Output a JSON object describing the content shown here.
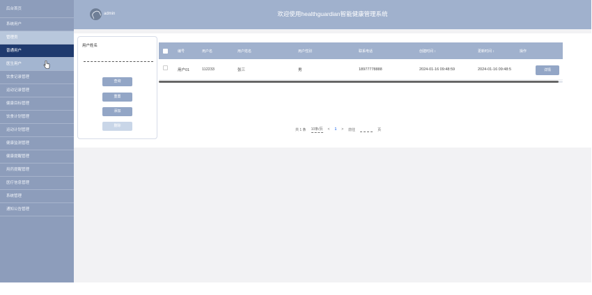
{
  "sidebar": {
    "items": [
      {
        "label": "后台首页",
        "state": "normal"
      },
      {
        "label": "系统用户",
        "state": "normal"
      },
      {
        "label": "管理员",
        "state": "light"
      },
      {
        "label": "普通用户",
        "state": "active"
      },
      {
        "label": "医生用户",
        "state": "mid"
      },
      {
        "label": "饮食记录管理",
        "state": "normal"
      },
      {
        "label": "运动记录管理",
        "state": "normal"
      },
      {
        "label": "健康目标管理",
        "state": "normal"
      },
      {
        "label": "饮食计划管理",
        "state": "normal"
      },
      {
        "label": "运动计划管理",
        "state": "normal"
      },
      {
        "label": "健康监测管理",
        "state": "normal"
      },
      {
        "label": "健康提醒管理",
        "state": "normal"
      },
      {
        "label": "用药提醒管理",
        "state": "normal"
      },
      {
        "label": "医疗信息管理",
        "state": "normal"
      },
      {
        "label": "系统管理",
        "state": "normal"
      },
      {
        "label": "通知公告管理",
        "state": "normal"
      }
    ]
  },
  "header": {
    "admin_name": "admin",
    "title": "欢迎使用healthguardian智能健康管理系统"
  },
  "search": {
    "label": "用户姓名",
    "input_value": "",
    "query_label": "查询",
    "reset_label": "重置",
    "add_label": "添加",
    "delete_label": "删除"
  },
  "table": {
    "columns": [
      "编号",
      "用户名",
      "用户姓名",
      "用户性别",
      "联系电话",
      "创建时间 ↕",
      "更新时间 ↕",
      "操作"
    ],
    "rows": [
      {
        "id": "用户01",
        "username": "112233",
        "name": "张三",
        "gender": "男",
        "phone": "18977778888",
        "created": "2024-01-16 09:48:59",
        "updated": "2024-01-16 09:48:5",
        "action": "详情"
      }
    ]
  },
  "pagination": {
    "total": "共 1 条",
    "page_size": "10条/页",
    "prev": "<",
    "current_page": "1",
    "next": ">",
    "goto_label": "前往",
    "page_unit": "页"
  },
  "colors": {
    "sidebar_bg": "#8d9dbb",
    "sidebar_active": "#1f3a6e",
    "header_bg": "#a0b1cd",
    "button_bg": "#93a6c6"
  }
}
